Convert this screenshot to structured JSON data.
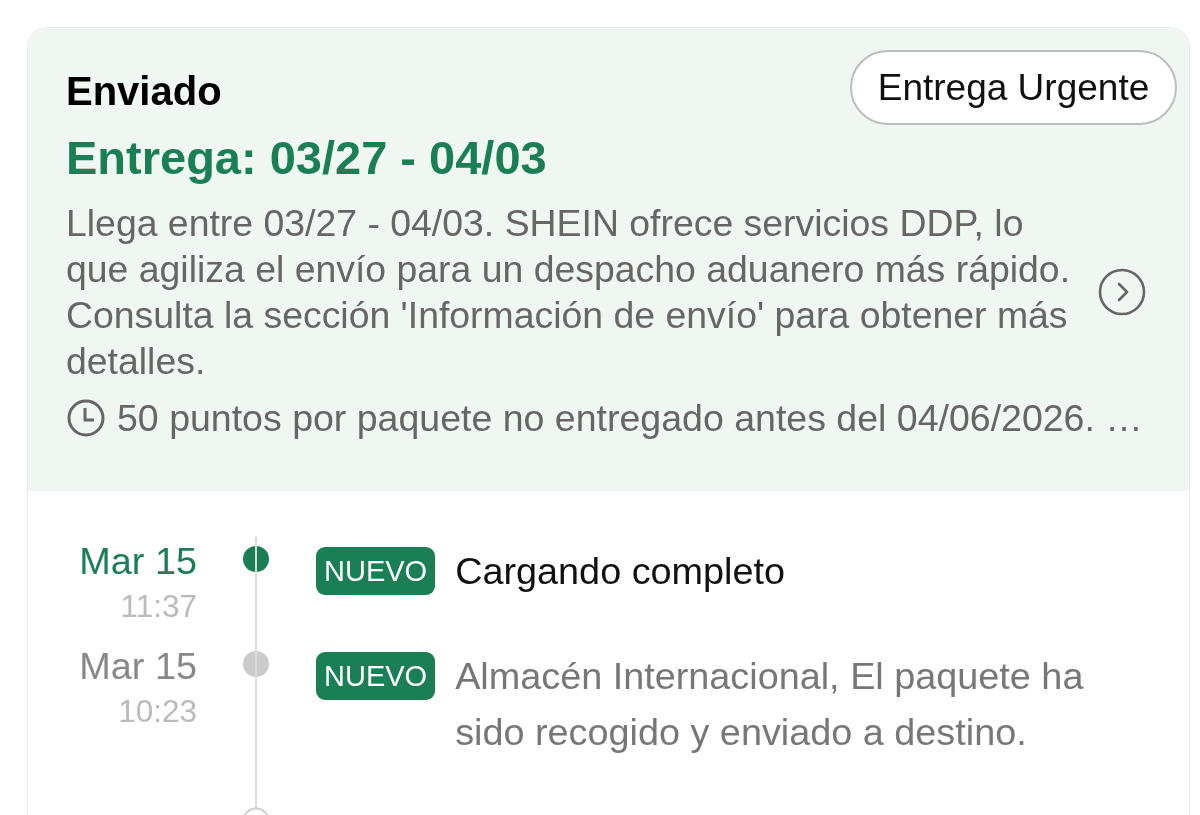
{
  "header": {
    "status": "Enviado",
    "delivery": "Entrega: 03/27 - 04/03",
    "urgent_button": "Entrega Urgente"
  },
  "info": {
    "text": "Llega entre 03/27 - 04/03. SHEIN ofrece servicios DDP, lo que agiliza el envío para un despacho aduanero más rápido. Consulta la sección 'Información de envío' para obtener más detalles.",
    "points_note": "50 puntos por paquete no entregado antes del 04/06/2026. …"
  },
  "timeline": [
    {
      "date": "Mar 15",
      "time": "11:37",
      "badge": "NUEVO",
      "text": "Cargando completo",
      "current": true
    },
    {
      "date": "Mar 15",
      "time": "10:23",
      "badge": "NUEVO",
      "text": "Almacén Internacional, El paquete ha sido recogido y enviado a destino.",
      "current": false
    }
  ]
}
